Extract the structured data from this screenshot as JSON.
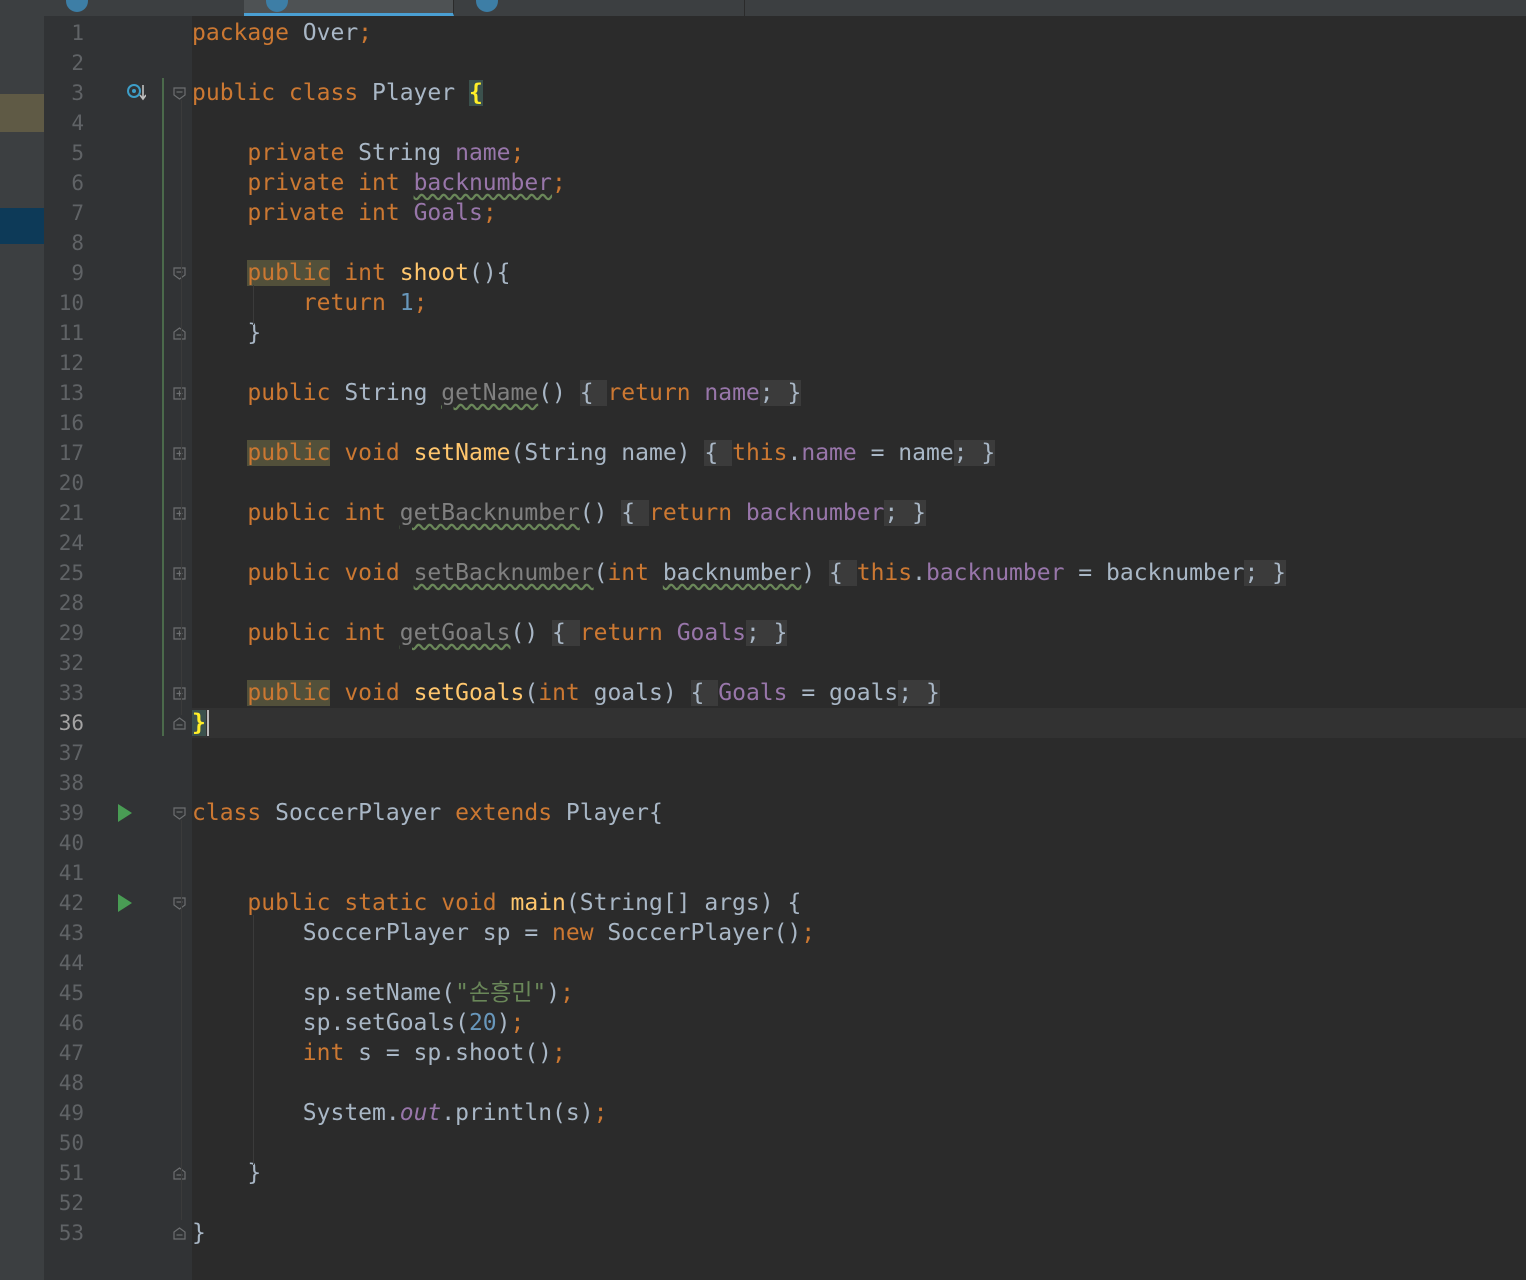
{
  "editor": {
    "language": "java",
    "current_line": "36",
    "lines": [
      {
        "n": "1",
        "tokens": [
          [
            "k",
            "package "
          ],
          [
            "t",
            "Over"
          ],
          [
            "k",
            ";"
          ]
        ]
      },
      {
        "n": "2",
        "tokens": []
      },
      {
        "n": "3",
        "tokens": [
          [
            "k",
            "public class "
          ],
          [
            "t",
            "Player "
          ],
          [
            "bh",
            "{"
          ]
        ],
        "override_icon": true,
        "fold": "open"
      },
      {
        "n": "4",
        "tokens": []
      },
      {
        "n": "5",
        "tokens": [
          [
            "t",
            "    "
          ],
          [
            "k",
            "private "
          ],
          [
            "t",
            "String "
          ],
          [
            "f",
            "name"
          ],
          [
            "k",
            ";"
          ]
        ]
      },
      {
        "n": "6",
        "tokens": [
          [
            "t",
            "    "
          ],
          [
            "k",
            "private int "
          ],
          [
            "fw",
            "backnumber"
          ],
          [
            "k",
            ";"
          ]
        ]
      },
      {
        "n": "7",
        "tokens": [
          [
            "t",
            "    "
          ],
          [
            "k",
            "private int "
          ],
          [
            "f",
            "Goals"
          ],
          [
            "k",
            ";"
          ]
        ]
      },
      {
        "n": "8",
        "tokens": []
      },
      {
        "n": "9",
        "tokens": [
          [
            "t",
            "    "
          ],
          [
            "ku",
            "public"
          ],
          [
            "k",
            " int "
          ],
          [
            "m",
            "shoot"
          ],
          [
            "t",
            "(){"
          ]
        ],
        "fold": "open"
      },
      {
        "n": "10",
        "tokens": [
          [
            "t",
            "        "
          ],
          [
            "k",
            "return "
          ],
          [
            "n",
            "1"
          ],
          [
            "k",
            ";"
          ]
        ]
      },
      {
        "n": "11",
        "tokens": [
          [
            "t",
            "    }"
          ]
        ],
        "fold": "close"
      },
      {
        "n": "12",
        "tokens": []
      },
      {
        "n": "13",
        "tokens": [
          [
            "t",
            "    "
          ],
          [
            "k",
            "public "
          ],
          [
            "t",
            "String "
          ],
          [
            "gw",
            "getName"
          ],
          [
            "t",
            "() "
          ],
          [
            "fo",
            "{ "
          ],
          [
            "k",
            "return "
          ],
          [
            "f",
            "name"
          ],
          [
            "fo",
            "; }"
          ]
        ],
        "fold": "collapsed"
      },
      {
        "n": "16",
        "tokens": []
      },
      {
        "n": "17",
        "tokens": [
          [
            "t",
            "    "
          ],
          [
            "ku",
            "public"
          ],
          [
            "k",
            " void "
          ],
          [
            "m",
            "setName"
          ],
          [
            "t",
            "(String name) "
          ],
          [
            "fo",
            "{ "
          ],
          [
            "k",
            "this"
          ],
          [
            "t",
            "."
          ],
          [
            "f",
            "name"
          ],
          [
            "t",
            " = name"
          ],
          [
            "fo",
            "; }"
          ]
        ],
        "fold": "collapsed"
      },
      {
        "n": "20",
        "tokens": []
      },
      {
        "n": "21",
        "tokens": [
          [
            "t",
            "    "
          ],
          [
            "k",
            "public int "
          ],
          [
            "gw",
            "getBacknumber"
          ],
          [
            "t",
            "() "
          ],
          [
            "fo",
            "{ "
          ],
          [
            "k",
            "return "
          ],
          [
            "f",
            "backnumber"
          ],
          [
            "fo",
            "; }"
          ]
        ],
        "fold": "collapsed"
      },
      {
        "n": "24",
        "tokens": []
      },
      {
        "n": "25",
        "tokens": [
          [
            "t",
            "    "
          ],
          [
            "k",
            "public void "
          ],
          [
            "gw",
            "setBacknumber"
          ],
          [
            "t",
            "("
          ],
          [
            "k",
            "int "
          ],
          [
            "tw",
            "backnumber"
          ],
          [
            "t",
            ") "
          ],
          [
            "fo",
            "{ "
          ],
          [
            "k",
            "this"
          ],
          [
            "t",
            "."
          ],
          [
            "f",
            "backnumber"
          ],
          [
            "t",
            " = backnumber"
          ],
          [
            "fo",
            "; }"
          ]
        ],
        "fold": "collapsed"
      },
      {
        "n": "28",
        "tokens": []
      },
      {
        "n": "29",
        "tokens": [
          [
            "t",
            "    "
          ],
          [
            "k",
            "public int "
          ],
          [
            "gw",
            "getGoals"
          ],
          [
            "t",
            "() "
          ],
          [
            "fo",
            "{ "
          ],
          [
            "k",
            "return "
          ],
          [
            "f",
            "Goals"
          ],
          [
            "fo",
            "; }"
          ]
        ],
        "fold": "collapsed"
      },
      {
        "n": "32",
        "tokens": []
      },
      {
        "n": "33",
        "tokens": [
          [
            "t",
            "    "
          ],
          [
            "ku",
            "public"
          ],
          [
            "k",
            " void "
          ],
          [
            "m",
            "setGoals"
          ],
          [
            "t",
            "("
          ],
          [
            "k",
            "int "
          ],
          [
            "t",
            "goals) "
          ],
          [
            "fo",
            "{ "
          ],
          [
            "f",
            "Goals"
          ],
          [
            "t",
            " = goals"
          ],
          [
            "fo",
            "; }"
          ]
        ],
        "fold": "collapsed"
      },
      {
        "n": "36",
        "tokens": [
          [
            "bh",
            "}"
          ]
        ],
        "fold": "close",
        "current": true
      },
      {
        "n": "37",
        "tokens": []
      },
      {
        "n": "38",
        "tokens": []
      },
      {
        "n": "39",
        "tokens": [
          [
            "k",
            "class "
          ],
          [
            "t",
            "SoccerPlayer "
          ],
          [
            "k",
            "extends "
          ],
          [
            "t",
            "Player{"
          ]
        ],
        "run_icon": true,
        "fold": "open"
      },
      {
        "n": "40",
        "tokens": []
      },
      {
        "n": "41",
        "tokens": []
      },
      {
        "n": "42",
        "tokens": [
          [
            "t",
            "    "
          ],
          [
            "k",
            "public static void "
          ],
          [
            "m",
            "main"
          ],
          [
            "t",
            "(String[] args) {"
          ]
        ],
        "run_icon": true,
        "fold": "open"
      },
      {
        "n": "43",
        "tokens": [
          [
            "t",
            "        SoccerPlayer sp = "
          ],
          [
            "k",
            "new "
          ],
          [
            "t",
            "SoccerPlayer()"
          ],
          [
            "k",
            ";"
          ]
        ]
      },
      {
        "n": "44",
        "tokens": []
      },
      {
        "n": "45",
        "tokens": [
          [
            "t",
            "        sp.setName("
          ],
          [
            "s",
            "\"손흥민\""
          ],
          [
            "t",
            ")"
          ],
          [
            "k",
            ";"
          ]
        ]
      },
      {
        "n": "46",
        "tokens": [
          [
            "t",
            "        sp.setGoals("
          ],
          [
            "n",
            "20"
          ],
          [
            "t",
            ")"
          ],
          [
            "k",
            ";"
          ]
        ]
      },
      {
        "n": "47",
        "tokens": [
          [
            "t",
            "        "
          ],
          [
            "k",
            "int "
          ],
          [
            "t",
            "s = sp.shoot()"
          ],
          [
            "k",
            ";"
          ]
        ]
      },
      {
        "n": "48",
        "tokens": []
      },
      {
        "n": "49",
        "tokens": [
          [
            "t",
            "        System."
          ],
          [
            "fi",
            "out"
          ],
          [
            "t",
            ".println(s)"
          ],
          [
            "k",
            ";"
          ]
        ]
      },
      {
        "n": "50",
        "tokens": []
      },
      {
        "n": "51",
        "tokens": [
          [
            "t",
            "    }"
          ]
        ],
        "fold": "close"
      },
      {
        "n": "52",
        "tokens": []
      },
      {
        "n": "53",
        "tokens": [
          [
            "t",
            "}"
          ]
        ],
        "fold": "close"
      }
    ]
  }
}
